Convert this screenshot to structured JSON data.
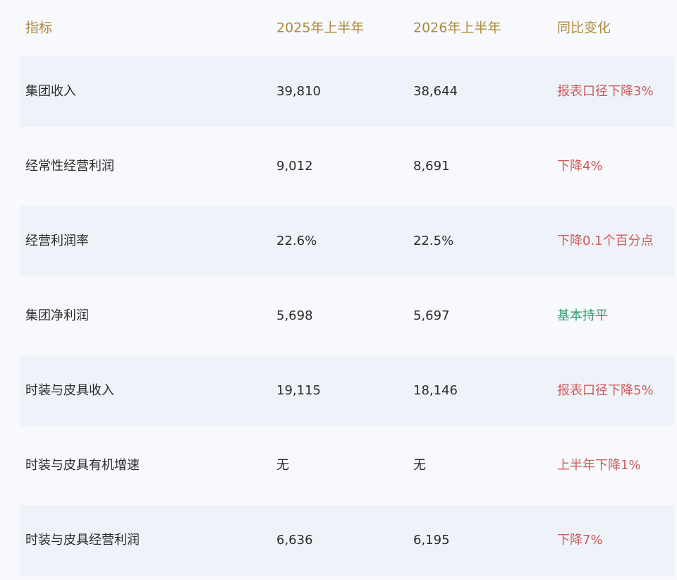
{
  "headers": [
    "指标",
    "2025年上半年",
    "2026年上半年",
    "同比变化"
  ],
  "colors": {
    "header_text": "#b08a3e",
    "decline": "#cf5a5a",
    "flat": "#2e9a6b",
    "row_shade": "#eef3f9"
  },
  "rows": [
    {
      "metric": "集团收入",
      "h1_2025": "39,810",
      "h1_2026": "38,644",
      "change": "报表口径下降3%",
      "trend": "down"
    },
    {
      "metric": "经常性经营利润",
      "h1_2025": "9,012",
      "h1_2026": "8,691",
      "change": "下降4%",
      "trend": "down"
    },
    {
      "metric": "经营利润率",
      "h1_2025": "22.6%",
      "h1_2026": "22.5%",
      "change": "下降0.1个百分点",
      "trend": "down"
    },
    {
      "metric": "集团净利润",
      "h1_2025": "5,698",
      "h1_2026": "5,697",
      "change": "基本持平",
      "trend": "flat"
    },
    {
      "metric": "时装与皮具收入",
      "h1_2025": "19,115",
      "h1_2026": "18,146",
      "change": "报表口径下降5%",
      "trend": "down"
    },
    {
      "metric": "时装与皮具有机增速",
      "h1_2025": "无",
      "h1_2026": "无",
      "change": "上半年下降1%",
      "trend": "down"
    },
    {
      "metric": "时装与皮具经营利润",
      "h1_2025": "6,636",
      "h1_2026": "6,195",
      "change": "下降7%",
      "trend": "down"
    }
  ]
}
